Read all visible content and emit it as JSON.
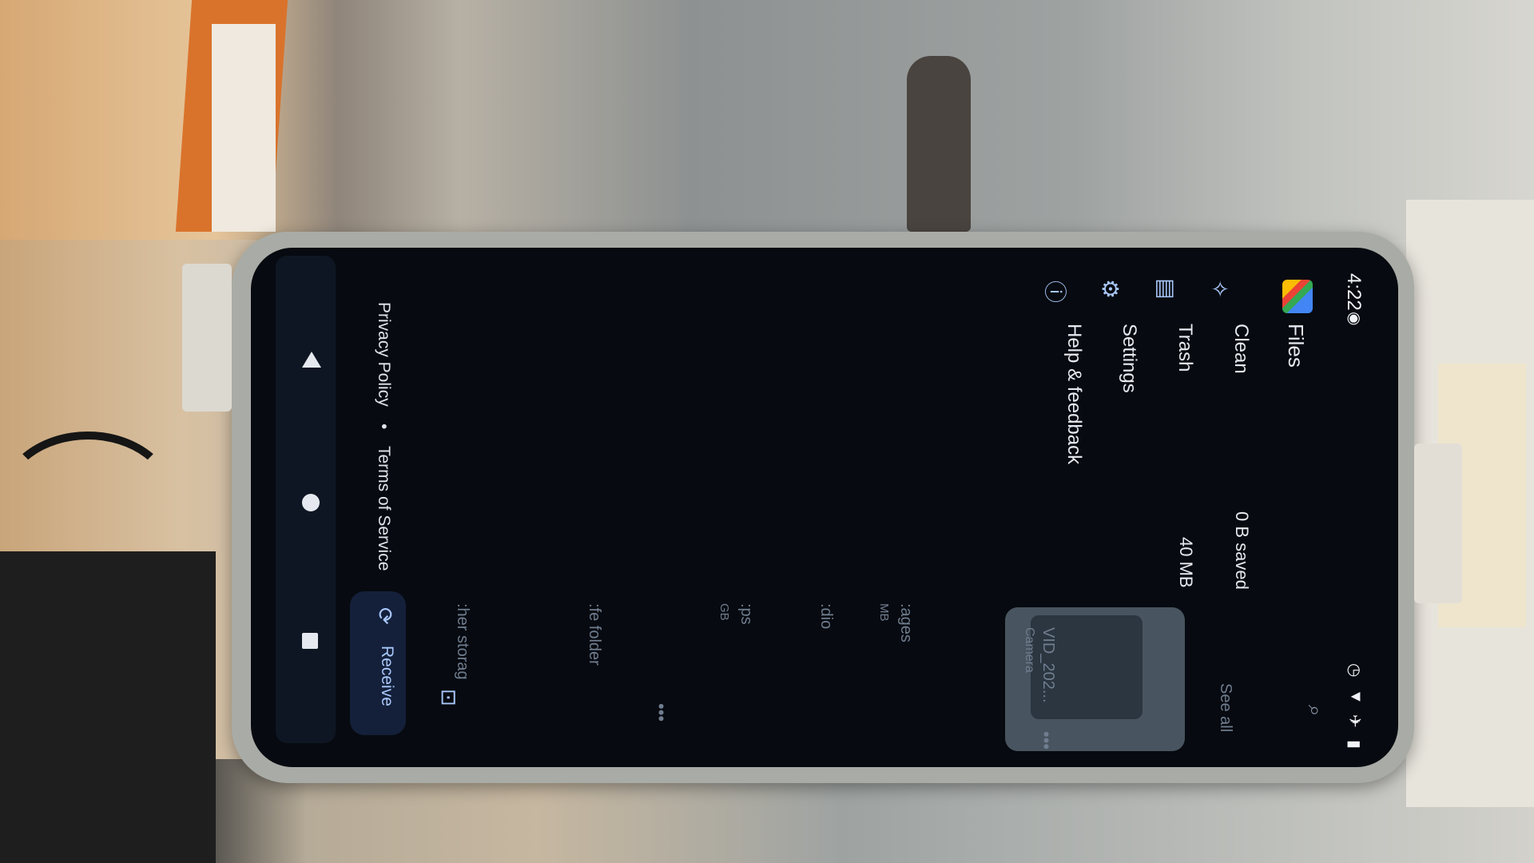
{
  "status_bar": {
    "time": "4:22"
  },
  "app": {
    "title": "Files"
  },
  "menu": [
    {
      "label": "Clean",
      "icon": "sparkle-icon"
    },
    {
      "label": "Trash",
      "icon": "trash-icon"
    },
    {
      "label": "Settings",
      "icon": "gear-icon"
    },
    {
      "label": "Help & feedback",
      "icon": "help-icon"
    }
  ],
  "summary": {
    "clean_saved": "0 B saved",
    "trash_size": "40 MB"
  },
  "footer": {
    "privacy": "Privacy Policy",
    "separator": "•",
    "terms": "Terms of Service"
  },
  "receive": {
    "label": "Receive"
  },
  "background_ui": {
    "see_all": "See all",
    "recent_file": "VID_202...",
    "recent_source": "Camera",
    "categories": [
      ":ages",
      "MB",
      ":dio",
      ":ps",
      "GB"
    ],
    "safe_folder": ":fe folder",
    "other_storage": ":her storag"
  },
  "colors": {
    "screen_bg": "#070a10",
    "accent": "#a8c7fa",
    "nav_bg": "#0f1623"
  }
}
